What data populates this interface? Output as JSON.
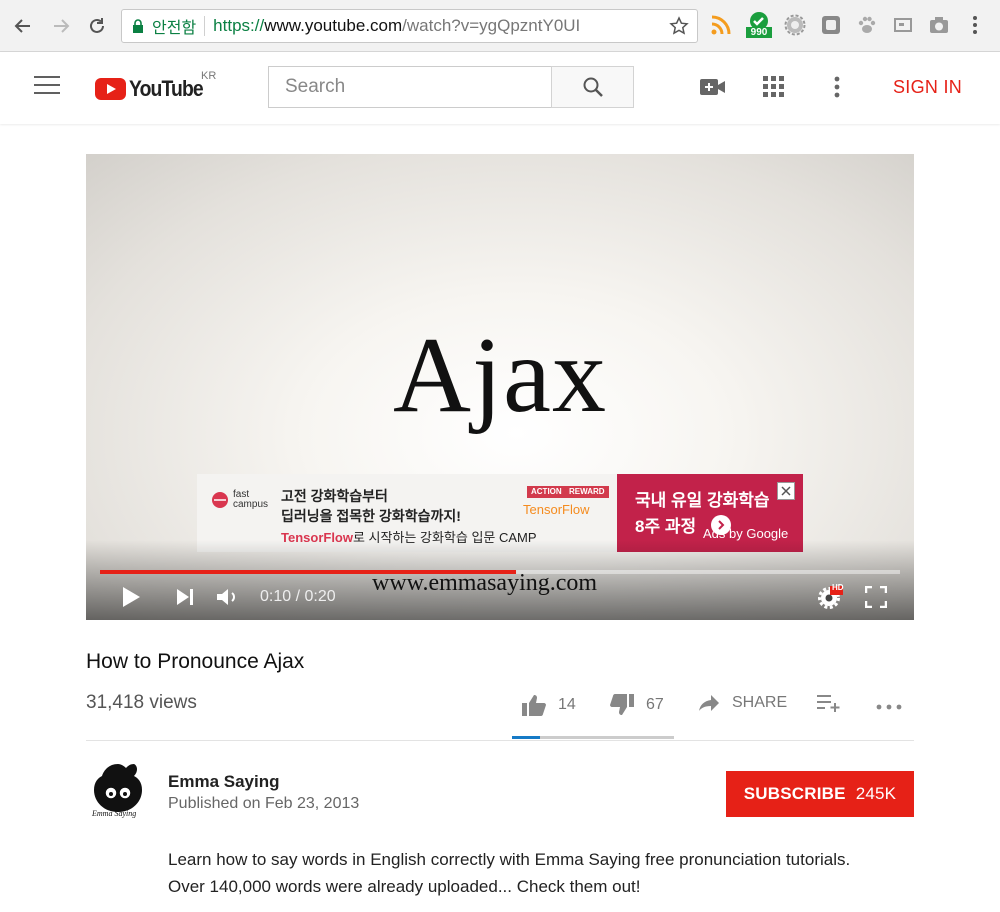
{
  "browser": {
    "security_label": "안전함",
    "url_scheme": "https://",
    "url_host": "www.youtube.com",
    "url_path": "/watch?v=ygQpzntY0UI",
    "extension_badge": "990"
  },
  "header": {
    "logo_text": "YouTube",
    "country": "KR",
    "search_placeholder": "Search",
    "sign_in": "SIGN IN"
  },
  "player": {
    "video_word": "Ajax",
    "watermark": "www.emmasaying.com",
    "time": "0:10 / 0:20",
    "progress": 0.52,
    "quality_badge": "HD",
    "ad": {
      "brand": [
        "fast",
        "campus"
      ],
      "line1": "고전 강화학습부터",
      "line2": "딥러닝을 접목한 강화학습까지!",
      "line3_brand": "TensorFlow",
      "line3_rest": "로 시작하는 강화학습 입문 CAMP",
      "tag_action": "ACTION",
      "tag_reward": "REWARD",
      "tf_logo": "TensorFlow",
      "right_line1": "국내 유일 강화학습",
      "right_line2": "8주 과정",
      "ads_by": "Ads by Google"
    }
  },
  "video": {
    "title": "How to Pronounce Ajax",
    "views": "31,418 views",
    "likes": "14",
    "dislikes": "67",
    "like_ratio": 0.17,
    "share": "SHARE"
  },
  "channel": {
    "name": "Emma Saying",
    "published": "Published on Feb 23, 2013",
    "subscribe": "SUBSCRIBE",
    "subscribers": "245K",
    "avatar_text": "Emma Saying"
  },
  "description": {
    "line1": "Learn how to say words in English correctly with Emma Saying free pronunciation tutorials.",
    "line2": "Over 140,000 words were already uploaded... Check them out!"
  },
  "colors": {
    "brand_red": "#e62117",
    "secure_green": "#0b8043",
    "like_blue": "#167ac6"
  }
}
